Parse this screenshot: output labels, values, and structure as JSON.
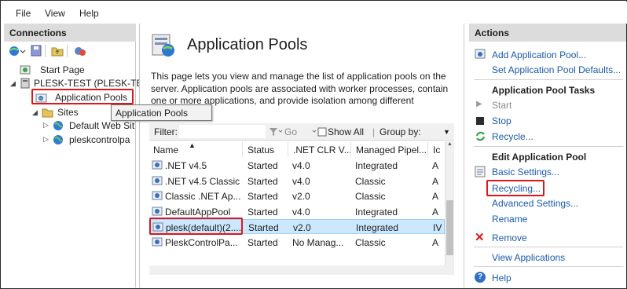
{
  "menu": {
    "file": "File",
    "view": "View",
    "help": "Help"
  },
  "connections": {
    "title": "Connections",
    "tree": {
      "start_page": "Start Page",
      "server": "PLESK-TEST (PLESK-TE",
      "app_pools": "Application Pools",
      "sites": "Sites",
      "site1": "Default Web Sit",
      "site2": "pleskcontrolpa"
    },
    "tooltip": "Application Pools"
  },
  "main": {
    "title": "Application Pools",
    "description": "This page lets you view and manage the list of application pools on the server. Application pools are associated with worker processes, contain one or more applications, and provide isolation among different applications.",
    "filter": {
      "label": "Filter:",
      "go": "Go",
      "show_all": "Show All",
      "group_by": "Group by:"
    },
    "columns": [
      "Name",
      "Status",
      ".NET CLR V...",
      "Managed Pipel...",
      "Ic"
    ],
    "rows": [
      [
        ".NET v4.5",
        "Started",
        "v4.0",
        "Integrated",
        "A"
      ],
      [
        ".NET v4.5 Classic",
        "Started",
        "v4.0",
        "Classic",
        "A"
      ],
      [
        "Classic .NET Ap...",
        "Started",
        "v2.0",
        "Classic",
        "A"
      ],
      [
        "DefaultAppPool",
        "Started",
        "v4.0",
        "Integrated",
        "A"
      ],
      [
        "plesk(default)(2....",
        "Started",
        "v2.0",
        "Integrated",
        "IV"
      ],
      [
        "PleskControlPa...",
        "Started",
        "No Manag...",
        "Classic",
        "A"
      ]
    ]
  },
  "actions": {
    "title": "Actions",
    "add_pool": "Add Application Pool...",
    "set_defaults": "Set Application Pool Defaults...",
    "tasks_header": "Application Pool Tasks",
    "start": "Start",
    "stop": "Stop",
    "recycle": "Recycle...",
    "edit_header": "Edit Application Pool",
    "basic_settings": "Basic Settings...",
    "recycling": "Recycling...",
    "advanced_settings": "Advanced Settings...",
    "rename": "Rename",
    "remove": "Remove",
    "view_apps": "View Applications",
    "help": "Help"
  },
  "colors": {
    "link": "#1a5aa8",
    "highlight_box": "#e0161b",
    "selection": "#cce8ff",
    "panel_header": "#dcdcdc"
  }
}
